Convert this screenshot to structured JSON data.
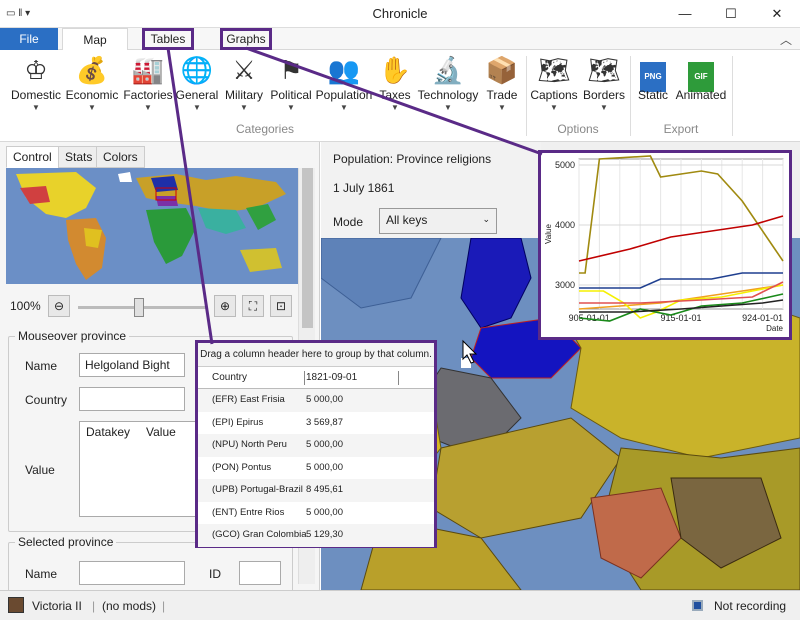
{
  "window": {
    "title": "Chronicle"
  },
  "ribbon_tabs": [
    {
      "label": "File"
    },
    {
      "label": "Map"
    },
    {
      "label": "Tables"
    },
    {
      "label": "Graphs"
    }
  ],
  "ribbon": {
    "categories": [
      {
        "label": "Domestic",
        "icon": "crown-icon"
      },
      {
        "label": "Economic",
        "icon": "money-bag-icon"
      },
      {
        "label": "Factories",
        "icon": "factory-icon"
      },
      {
        "label": "General",
        "icon": "globe-icon"
      },
      {
        "label": "Military",
        "icon": "cannon-icon"
      },
      {
        "label": "Political",
        "icon": "flag-icon"
      },
      {
        "label": "Population",
        "icon": "people-icon"
      },
      {
        "label": "Taxes",
        "icon": "taxes-icon"
      },
      {
        "label": "Technology",
        "icon": "microscope-icon"
      },
      {
        "label": "Trade",
        "icon": "crate-icon"
      }
    ],
    "options": [
      {
        "label": "Captions",
        "icon": "map-caption-icon"
      },
      {
        "label": "Borders",
        "icon": "map-borders-icon"
      }
    ],
    "export": [
      {
        "label": "Static",
        "icon": "png-file-icon",
        "badge": "PNG"
      },
      {
        "label": "Animated",
        "icon": "gif-file-icon",
        "badge": "GIF"
      }
    ],
    "group_labels": {
      "categories": "Categories",
      "options": "Options",
      "export": "Export"
    }
  },
  "left_panel": {
    "tabs": [
      {
        "label": "Control"
      },
      {
        "label": "Stats"
      },
      {
        "label": "Colors"
      }
    ],
    "zoom": "100%",
    "mouseover": {
      "title": "Mouseover province",
      "name_label": "Name",
      "name_value": "Helgoland Bight",
      "country_label": "Country",
      "country_value": "",
      "value_label": "Value",
      "grid_headers": [
        "Datakey",
        "Value"
      ]
    },
    "selected": {
      "title": "Selected province",
      "name_label": "Name",
      "id_label": "ID"
    }
  },
  "info": {
    "title": "Population: Province religions",
    "date": "1 July 1861",
    "mode_label": "Mode",
    "mode_value": "All keys"
  },
  "table_overlay": {
    "hint": "Drag a column header here to group by that column.",
    "headers": [
      "Country",
      "1821-09-01"
    ],
    "rows": [
      [
        "(EFR) East Frisia",
        "5 000,00"
      ],
      [
        "(EPI) Epirus",
        "3 569,87"
      ],
      [
        "(NPU) North Peru",
        "5 000,00"
      ],
      [
        "(PON) Pontus",
        "5 000,00"
      ],
      [
        "(UPB) Portugal-Brazil",
        "8 495,61"
      ],
      [
        "(ENT) Entre Rios",
        "5 000,00"
      ],
      [
        "(GCO) Gran Colombia",
        "5 129,30"
      ]
    ]
  },
  "chart_data": {
    "type": "line",
    "ylabel": "Value",
    "xlabel": "Date",
    "x_ticks": [
      "905-01-01",
      "915-01-01",
      "924-01-01"
    ],
    "y_ticks": [
      3000,
      4000,
      5000
    ],
    "ylim": [
      2600,
      5100
    ],
    "grid": true,
    "colors": {
      "olive": "#a08a10",
      "red": "#c00000",
      "navy": "#1f3f8f",
      "orange": "#f0a020",
      "yellow": "#f5f000",
      "green": "#1a8a1a",
      "black": "#222222",
      "lightred": "#e05050"
    },
    "series": [
      {
        "color": "#a08a10",
        "points": [
          [
            0,
            3200
          ],
          [
            0.03,
            3200
          ],
          [
            0.1,
            5100
          ],
          [
            0.35,
            5150
          ],
          [
            0.4,
            4800
          ],
          [
            0.6,
            4900
          ],
          [
            0.68,
            4850
          ],
          [
            0.8,
            4400
          ],
          [
            0.88,
            4000
          ],
          [
            0.96,
            3600
          ],
          [
            1,
            3400
          ]
        ]
      },
      {
        "color": "#c00000",
        "points": [
          [
            0,
            3400
          ],
          [
            0.25,
            3600
          ],
          [
            0.45,
            3800
          ],
          [
            0.65,
            3900
          ],
          [
            0.85,
            4000
          ],
          [
            1,
            4150
          ]
        ]
      },
      {
        "color": "#1f3f8f",
        "points": [
          [
            0,
            2950
          ],
          [
            0.3,
            2950
          ],
          [
            0.4,
            3100
          ],
          [
            0.65,
            3100
          ],
          [
            0.8,
            3200
          ],
          [
            1,
            3200
          ]
        ]
      },
      {
        "color": "#f0a020",
        "points": [
          [
            0,
            2600
          ],
          [
            0.2,
            2650
          ],
          [
            0.4,
            2700
          ],
          [
            0.6,
            2800
          ],
          [
            0.8,
            2900
          ],
          [
            1,
            3000
          ]
        ]
      },
      {
        "color": "#f5f000",
        "points": [
          [
            0,
            2900
          ],
          [
            0.12,
            2900
          ],
          [
            0.22,
            2700
          ],
          [
            0.3,
            2450
          ],
          [
            0.38,
            2550
          ],
          [
            0.5,
            2750
          ],
          [
            0.7,
            2800
          ],
          [
            0.85,
            2900
          ],
          [
            1,
            3000
          ]
        ]
      },
      {
        "color": "#1a8a1a",
        "points": [
          [
            0,
            2450
          ],
          [
            0.15,
            2400
          ],
          [
            0.3,
            2600
          ],
          [
            0.45,
            2500
          ],
          [
            0.6,
            2650
          ],
          [
            0.8,
            2700
          ],
          [
            1,
            2850
          ]
        ]
      },
      {
        "color": "#222222",
        "points": [
          [
            0,
            2550
          ],
          [
            0.25,
            2550
          ],
          [
            0.5,
            2600
          ],
          [
            0.7,
            2650
          ],
          [
            0.9,
            2700
          ],
          [
            1,
            2750
          ]
        ]
      },
      {
        "color": "#e05050",
        "points": [
          [
            0,
            2700
          ],
          [
            0.3,
            2700
          ],
          [
            0.6,
            2750
          ],
          [
            0.85,
            2800
          ],
          [
            1,
            3050
          ]
        ]
      }
    ]
  },
  "status": {
    "game": "Victoria II",
    "mods": "(no mods)",
    "recording": "Not recording"
  }
}
